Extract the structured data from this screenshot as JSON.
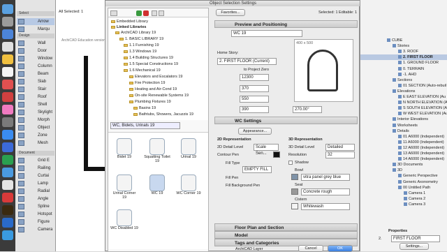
{
  "toolbox": {
    "select_label": "Select",
    "arrow": "Arrow",
    "marquee": "Marqu",
    "design_label": "Design",
    "tools": [
      "Wall",
      "Door",
      "Window",
      "Column",
      "Beam",
      "Slab",
      "Stair",
      "Roof",
      "Shell",
      "Skylight",
      "Morph",
      "Object",
      "Zone",
      "Mesh"
    ],
    "document_label": "Document",
    "doc_tools": [
      "Grid E",
      "Railing",
      "Curtai",
      "Lamp",
      "Radial",
      "Angle",
      "Spline",
      "Hotspot",
      "Figure",
      "Camera"
    ]
  },
  "plan": {
    "all_selected": "All Selected: 1",
    "edu_text": "ArchiCAD Education version"
  },
  "dialog": {
    "title": "Object Selection Settings",
    "favorites": "Favorites...",
    "selected_info": "Selected: 1 Editable: 1",
    "library": {
      "embedded": "Embedded Library",
      "linked": "Linked Libraries",
      "items": [
        "ArchiCAD Library 19",
        "1. BASIC LIBRARY 19",
        "1.1 Furnishing 19",
        "1.3 Windows 19",
        "1.4 Building Structures 19",
        "1.5 Special Constructions 19",
        "1.6 Mechanical 19",
        "Elevators and Escalators 19",
        "Fire Protection 19",
        "Heating and Air-Cond 19",
        "On-site Renewable Systems 19",
        "Plumbing Fixtures 19",
        "Basins 19",
        "Bathtubs, Showers, Jacuzzis 19"
      ],
      "folder_select": "WC, Bidets, Urinals 19",
      "thumbs": [
        "Bidet 19",
        "Squatting Toilet 19",
        "Urinal 19",
        "Urinal Corner 19",
        "WC 19",
        "WC Corner 19",
        "WC Disabled 19"
      ]
    },
    "preview": {
      "header": "Preview and Positioning",
      "name": "WC 19",
      "home_story_label": "Home Story:",
      "home_story": "2. FIRST FLOOR (Current)",
      "to_project_zero": "to Project Zero",
      "elev": "12300",
      "width": "370",
      "depth": "550",
      "height": "390",
      "angle": "270.00°",
      "dim_label": "400 x 500"
    },
    "wc_settings": {
      "header": "WC Settings",
      "appearance": "Appearance...",
      "rep2d": "2D Representation",
      "detail_level_2d_label": "2D Detail Level",
      "detail_level_2d": "Scale Sen...",
      "contour_pen": "Contour Pen",
      "fill_type": "Fill Type",
      "fill_type_value": "EMPTY FILL",
      "fill_pen": "Fill Pen",
      "fill_bg_pen": "Fill Background Pen",
      "rep3d": "3D Representation",
      "detail_level_3d_label": "3D Detail Level",
      "detail_level_3d": "Detailed",
      "resolution_label": "Resolution",
      "resolution": "32",
      "shadow": "Shadow",
      "bowl": "Bowl",
      "bowl_mat": "vitra panel grey blue",
      "seat": "Seat",
      "seat_mat": "Concrete rough",
      "cistern": "Cistern",
      "cistern_mat": "Whitewash"
    },
    "sections": [
      "Floor Plan and Section",
      "Model",
      "Tags and Categories"
    ],
    "layer": "ArchiCAD Layer",
    "cancel": "Cancel",
    "ok": "OK"
  },
  "navigator": {
    "rows": [
      "CUBE",
      "Stories",
      "3. ROOF",
      "2. FIRST FLOOR",
      "1. GROUND FLOOR",
      "0. TERRAIN",
      "-1. AHD",
      "Sections",
      "01 SECTION (Auto-rebuil",
      "Elevations",
      "E EAST ELEVATION (Au",
      "N NORTH ELEVATION (A",
      "S SOUTH ELEVATION (A",
      "W WEST ELEVATION (Au",
      "Interior Elevations",
      "Worksheets",
      "Details",
      "01 A6000 (Independent)",
      "11 A6000 (Independent)",
      "12 A6000 (Independent)",
      "13 A6000 (Independent)",
      "14 A6000 (Independent)",
      "3D Documents",
      "3D",
      "Generic Perspective",
      "Generic Axonometry",
      "00 Untitled Path",
      "Camera 1",
      "Camera 2",
      "Camera 3"
    ],
    "properties": "Properties",
    "story_num": "2.",
    "story_name": "FIRST FLOOR",
    "settings_btn": "Settings..."
  }
}
